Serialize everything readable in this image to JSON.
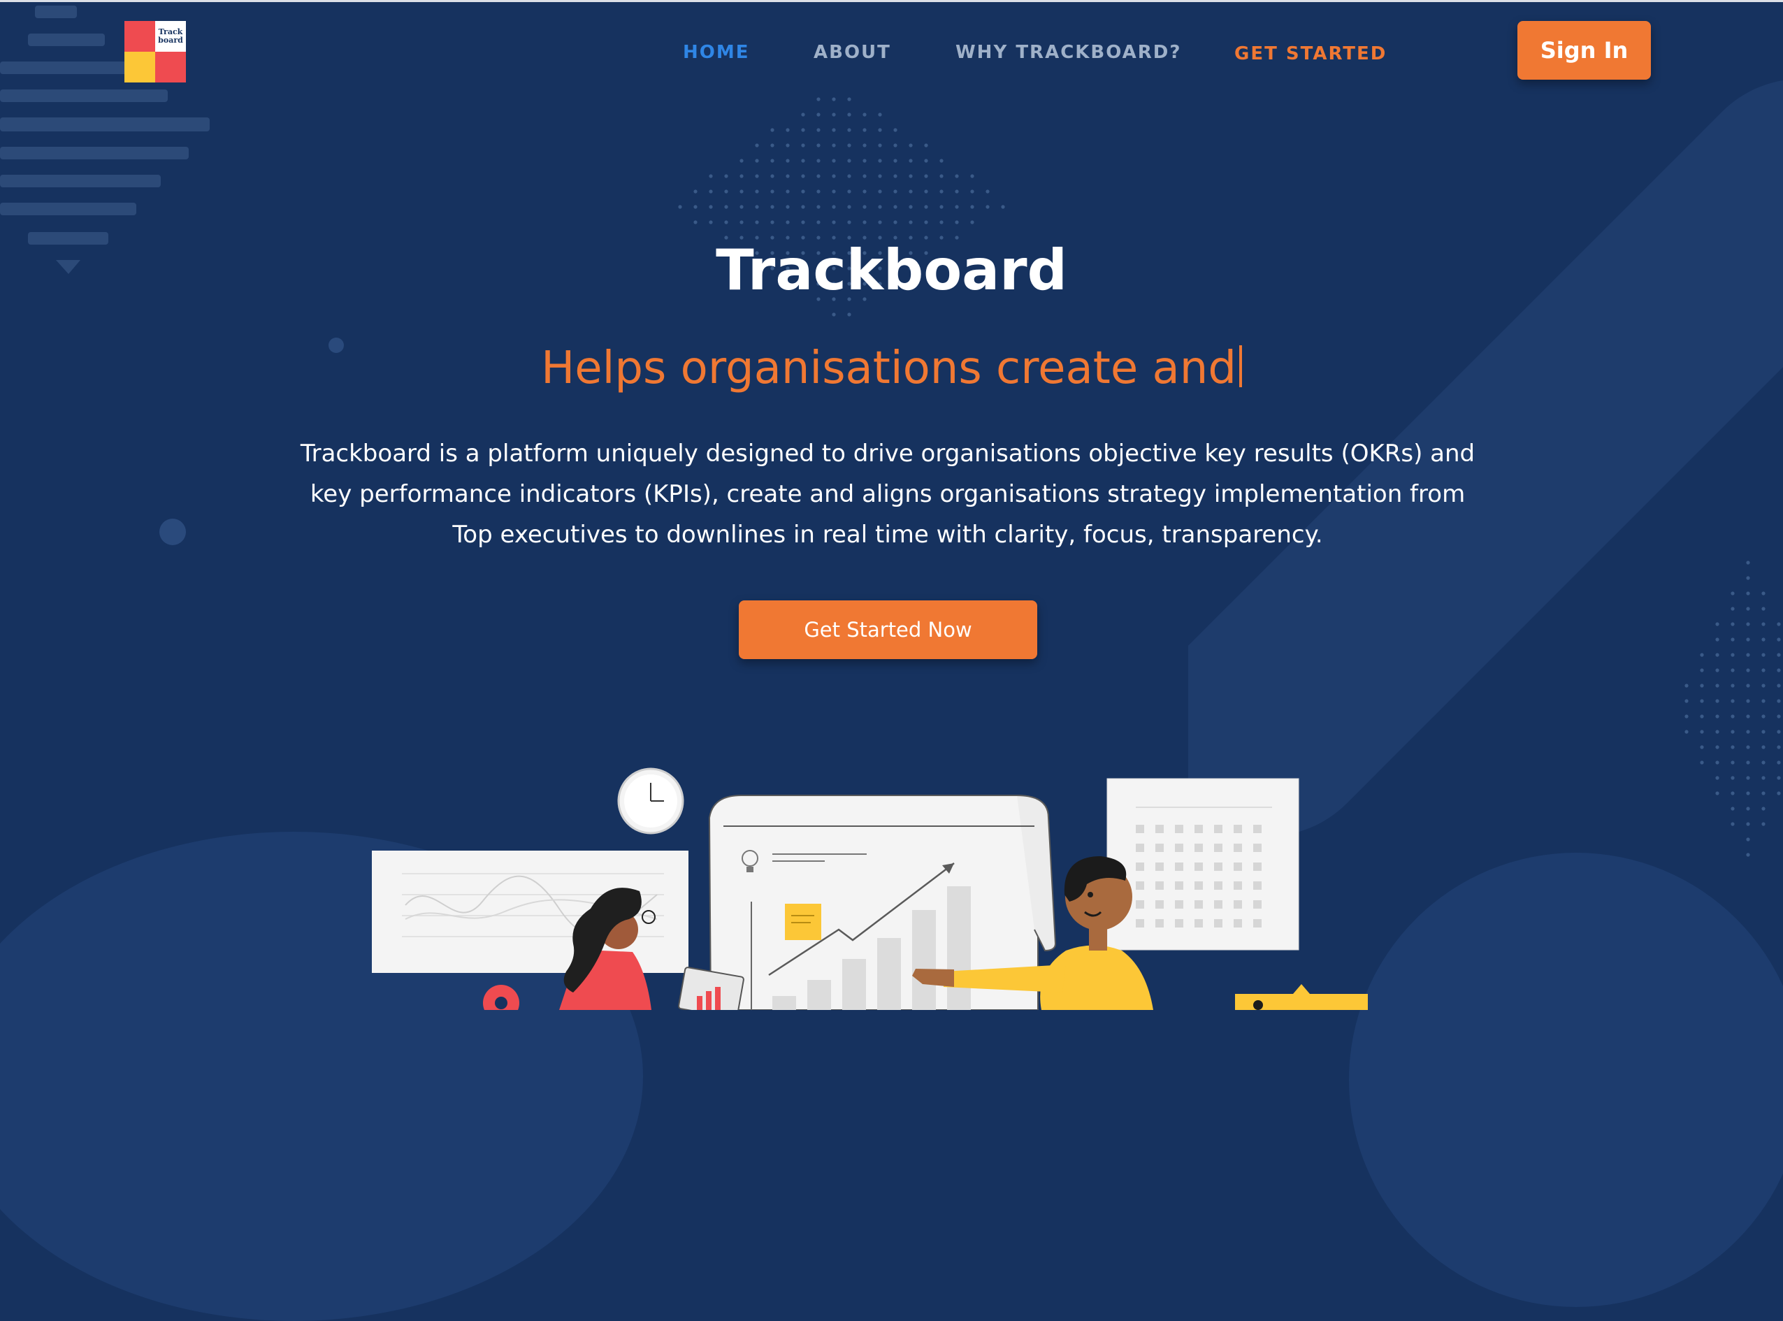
{
  "header": {
    "logo": {
      "line1": "Track",
      "line2": "board"
    },
    "nav": [
      {
        "label": "HOME",
        "active": true
      },
      {
        "label": "ABOUT",
        "active": false
      },
      {
        "label": "WHY TRACKBOARD?",
        "active": false
      },
      {
        "label": "GET STARTED",
        "active": false
      }
    ],
    "sign_in_label": "Sign In"
  },
  "hero": {
    "title": "Trackboard",
    "typed_subtitle": "Helps organisations create and",
    "description": "Trackboard is a platform uniquely designed to drive organisations objective key results (OKRs) and key performance indicators (KPIs), create and aligns organisations strategy implementation from Top executives to downlines in real time with clarity, focus, transparency.",
    "cta_label": "Get Started Now"
  },
  "colors": {
    "background": "#16325f",
    "accent_orange": "#f07833",
    "nav_active_blue": "#2f86e6",
    "nav_text": "#9fb1c9",
    "logo_red": "#ef4b50",
    "logo_yellow": "#fcc737"
  },
  "icons": [
    "clock-icon",
    "lightbulb-icon",
    "gear-icon",
    "sticky-note-icon"
  ]
}
